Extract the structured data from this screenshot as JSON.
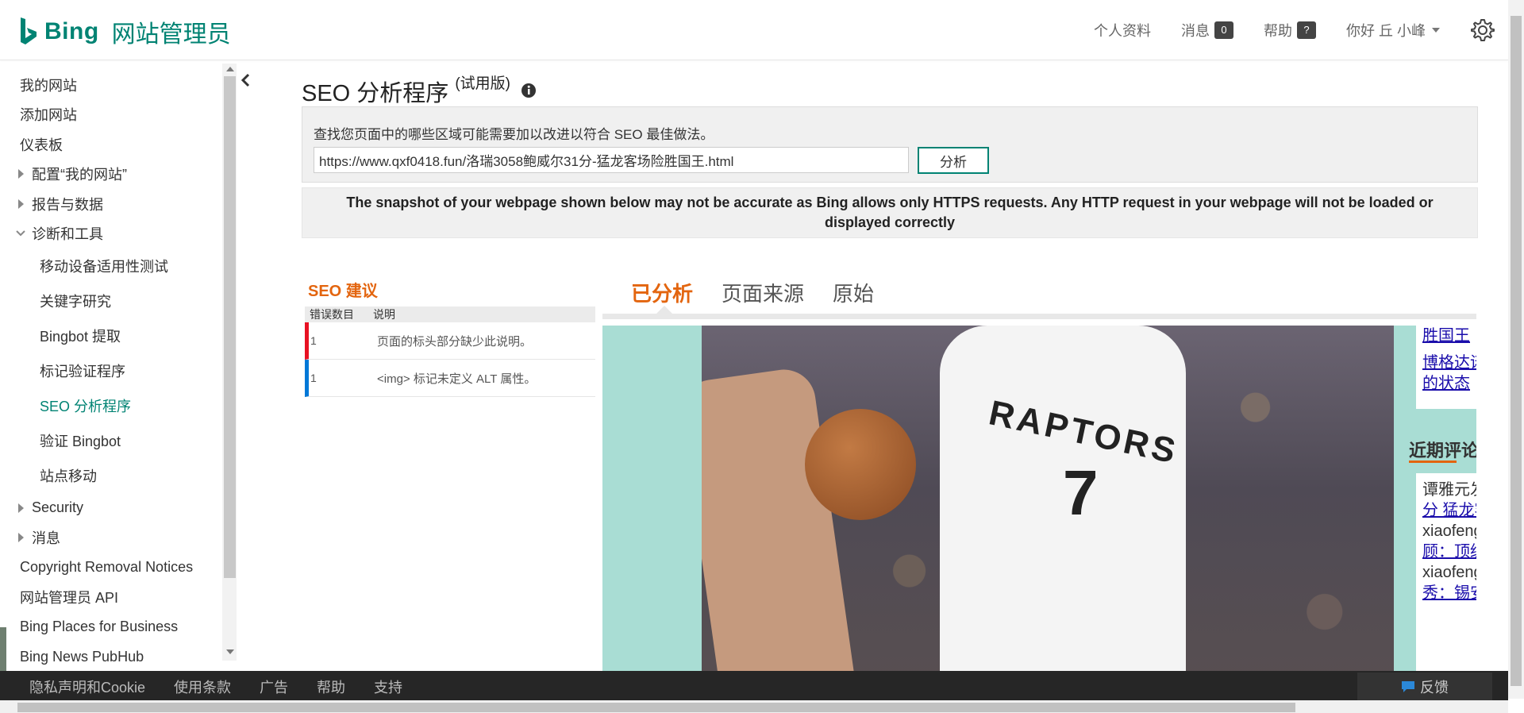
{
  "header": {
    "brand": "Bing",
    "product": "网站管理员",
    "nav": {
      "profile": "个人资料",
      "messages": "消息",
      "messages_count": "0",
      "help": "帮助",
      "help_badge": "?",
      "greeting": "你好 丘 小峰"
    }
  },
  "sidebar": {
    "items": [
      {
        "label": "我的网站"
      },
      {
        "label": "添加网站"
      },
      {
        "label": "仪表板"
      },
      {
        "label": "配置“我的网站”"
      },
      {
        "label": "报告与数据"
      },
      {
        "label": "诊断和工具"
      },
      {
        "label": "移动设备适用性测试"
      },
      {
        "label": "关键字研究"
      },
      {
        "label": "Bingbot 提取"
      },
      {
        "label": "标记验证程序"
      },
      {
        "label": "SEO 分析程序"
      },
      {
        "label": "验证 Bingbot"
      },
      {
        "label": "站点移动"
      },
      {
        "label": "Security"
      },
      {
        "label": "消息"
      },
      {
        "label": "Copyright Removal Notices"
      },
      {
        "label": "网站管理员 API"
      },
      {
        "label": "Bing Places for Business"
      },
      {
        "label": "Bing News PubHub"
      }
    ]
  },
  "main": {
    "title": "SEO 分析程序",
    "title_suffix": "(试用版)",
    "description": "查找您页面中的哪些区域可能需要加以改进以符合 SEO 最佳做法。",
    "url_value": "https://www.qxf0418.fun/洛瑞3058鲍威尔31分-猛龙客场险胜国王.html",
    "analyze_button": "分析",
    "notice": "The snapshot of your webpage shown below may not be accurate as Bing allows only HTTPS requests. Any HTTP request in your webpage will not be loaded or displayed correctly",
    "seo": {
      "heading": "SEO 建议",
      "col_count": "错误数目",
      "col_desc": "说明",
      "rows": [
        {
          "count": "1",
          "desc": "页面的标头部分缺少此说明。"
        },
        {
          "count": "1",
          "desc": "<img> 标记未定义 ALT 属性。"
        }
      ]
    },
    "tabs": [
      {
        "label": "已分析"
      },
      {
        "label": "页面来源"
      },
      {
        "label": "原始"
      }
    ],
    "preview": {
      "jersey_text": "RAPTORS",
      "jersey_number": "7",
      "side_links_top": [
        "胜国王",
        "博格达诺维",
        "的状态"
      ],
      "recent_title": "近期评论",
      "recent_lines": [
        {
          "text": "谭雅元发表在",
          "link": false
        },
        {
          "text": "分 猛龙客场",
          "link": true
        },
        {
          "text": "xiaofeng发表",
          "link": false
        },
        {
          "text": "顾：顶级阵",
          "link": true
        },
        {
          "text": "xiaofeng发表",
          "link": false
        },
        {
          "text": "秀：锡安-威",
          "link": true
        }
      ]
    }
  },
  "footer": {
    "links": [
      "隐私声明和Cookie",
      "使用条款",
      "广告",
      "帮助",
      "支持"
    ],
    "feedback": "反馈"
  }
}
